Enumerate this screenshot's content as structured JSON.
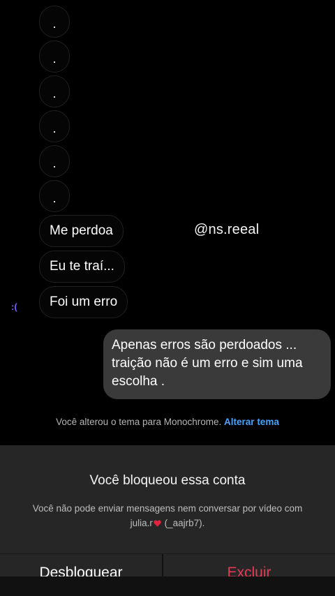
{
  "chat": {
    "dots": [
      ".",
      ".",
      ".",
      ".",
      ".",
      "."
    ],
    "incoming": [
      "Me perdoa",
      "Eu te traí...",
      "Foi um erro"
    ],
    "watermark": "@ns.reeal",
    "reaction": ":(",
    "outgoing": "Apenas erros são perdoados ... traição não é um erro e sim uma escolha ."
  },
  "system": {
    "theme_text": "Você alterou o tema para Monochrome.",
    "theme_link": "Alterar tema"
  },
  "block": {
    "title": "Você bloqueou essa conta",
    "desc_part1": "Você não pode enviar mensagens nem conversar por vídeo com julia.r",
    "desc_part2": " (_aajrb7).",
    "unblock_label": "Desbloquear",
    "delete_label": "Excluir"
  },
  "colors": {
    "link": "#4aa3ff",
    "danger": "#e53a56",
    "heart": "#e0243f",
    "reaction": "#7b5cff"
  }
}
